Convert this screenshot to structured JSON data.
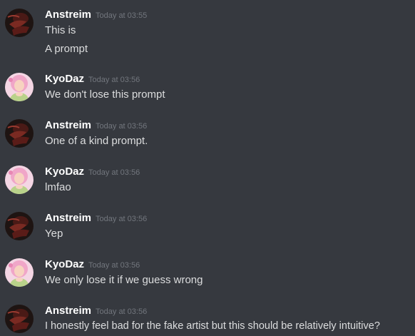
{
  "users": {
    "anstreim": {
      "name": "Anstreim",
      "avatar_icon": "dark-red-figure-avatar-icon"
    },
    "kyodaz": {
      "name": "KyoDaz",
      "avatar_icon": "pink-hair-girl-avatar-icon"
    }
  },
  "messages": [
    {
      "author": "Anstreim",
      "time": "Today at 03:55",
      "lines": [
        "This is",
        "A prompt"
      ]
    },
    {
      "author": "KyoDaz",
      "time": "Today at 03:56",
      "lines": [
        "We don't lose this prompt"
      ]
    },
    {
      "author": "Anstreim",
      "time": "Today at 03:56",
      "lines": [
        "One of a kind prompt."
      ]
    },
    {
      "author": "KyoDaz",
      "time": "Today at 03:56",
      "lines": [
        "lmfao"
      ]
    },
    {
      "author": "Anstreim",
      "time": "Today at 03:56",
      "lines": [
        "Yep"
      ]
    },
    {
      "author": "KyoDaz",
      "time": "Today at 03:56",
      "lines": [
        "We only lose it if we guess wrong"
      ]
    },
    {
      "author": "Anstreim",
      "time": "Today at 03:56",
      "lines": [
        "I honestly feel bad for the fake artist but this should be relatively intuitive?"
      ]
    }
  ],
  "colors": {
    "background": "#36393f",
    "username": "#ffffff",
    "text": "#dcddde",
    "timestamp": "#72767d"
  }
}
